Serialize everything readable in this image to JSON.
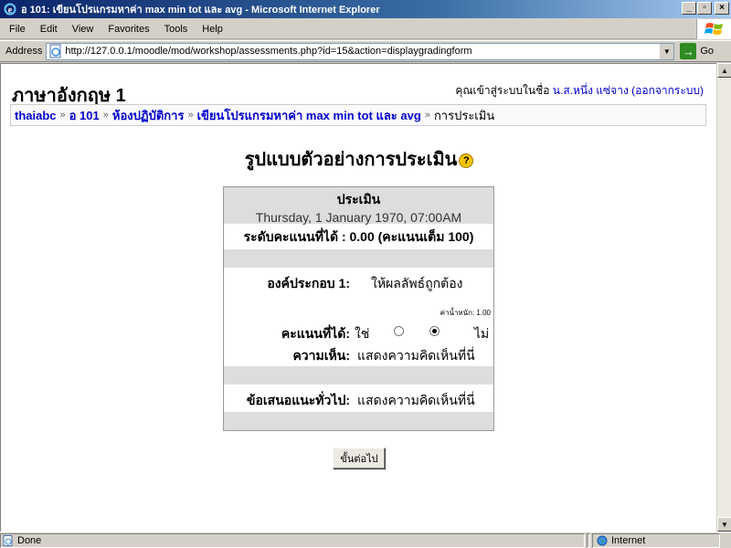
{
  "window": {
    "title": "อ 101: เขียนโปรแกรมหาค่า max min tot และ avg - Microsoft Internet Explorer",
    "buttons": {
      "minimize": "_",
      "maximize": "▫",
      "close": "×"
    }
  },
  "menu": [
    "File",
    "Edit",
    "View",
    "Favorites",
    "Tools",
    "Help"
  ],
  "address": {
    "label": "Address",
    "url": "http://127.0.0.1/moodle/mod/workshop/assessments.php?id=15&action=displaygradingform",
    "go_label": "Go"
  },
  "header": {
    "course_title": "ภาษาอังกฤษ 1",
    "login_prefix": "คุณเข้าสู่ระบบในชื่อ",
    "user_name": "น.ส.หนึ่ง แซ่จาง",
    "logout_label": "(ออกจากระบบ)"
  },
  "breadcrumb": [
    "thaiabc",
    "อ 101",
    "ห้องปฏิบัติการ",
    "เขียนโปรแกรมหาค่า max min tot และ avg",
    "การประเมิน"
  ],
  "page_title": "รูปแบบตัวอย่างการประเมิน",
  "form": {
    "heading": "ประเมิน",
    "date": "Thursday, 1 January 1970, 07:00AM",
    "score_line": "ระดับคะแนนที่ได้ : 0.00 (คะแนนเต็ม 100)",
    "element_label": "องค์ประกอบ 1:",
    "element_value": "ให้ผลลัพธ์ถูกต้อง",
    "weight_label": "ค่าน้ำหนัก: 1.00",
    "grade_label": "คะแนนที่ได้:",
    "yes_label": "ใช่",
    "no_label": "ไม่",
    "selected": "no",
    "comment_label": "ความเห็น:",
    "comment_value": "แสดงความคิดเห็นที่นี่",
    "general_label": "ข้อเสนอแนะทั่วไป:",
    "general_value": "แสดงความคิดเห็นที่นี่"
  },
  "submit_label": "ขั้นต่อไป",
  "status": {
    "text": "Done",
    "zone": "Internet"
  }
}
